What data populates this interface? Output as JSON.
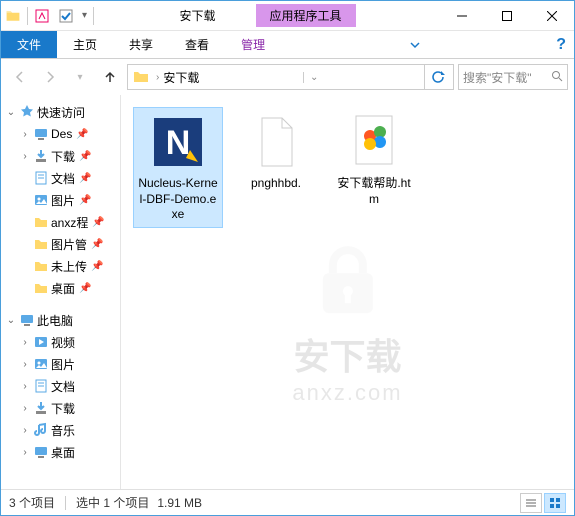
{
  "window": {
    "title": "安下载",
    "context_tab": "应用程序工具"
  },
  "ribbon": {
    "file": "文件",
    "home": "主页",
    "share": "共享",
    "view": "查看",
    "manage": "管理"
  },
  "breadcrumb": {
    "current": "安下载"
  },
  "search": {
    "placeholder": "搜索\"安下载\""
  },
  "sidebar": {
    "quick_access": "快速访问",
    "items_qa": [
      {
        "label": "Des",
        "icon": "desktop"
      },
      {
        "label": "下载",
        "icon": "downloads"
      },
      {
        "label": "文档",
        "icon": "documents"
      },
      {
        "label": "图片",
        "icon": "pictures"
      },
      {
        "label": "anxz程",
        "icon": "folder"
      },
      {
        "label": "图片管",
        "icon": "folder"
      },
      {
        "label": "未上传",
        "icon": "folder"
      },
      {
        "label": "桌面",
        "icon": "folder"
      }
    ],
    "this_pc": "此电脑",
    "items_pc": [
      {
        "label": "视频",
        "icon": "videos"
      },
      {
        "label": "图片",
        "icon": "pictures"
      },
      {
        "label": "文档",
        "icon": "documents"
      },
      {
        "label": "下载",
        "icon": "downloads"
      },
      {
        "label": "音乐",
        "icon": "music"
      },
      {
        "label": "桌面",
        "icon": "desktop"
      }
    ]
  },
  "files": [
    {
      "name": "Nucleus-Kernel-DBF-Demo.exe",
      "type": "exe",
      "selected": true
    },
    {
      "name": "pnghhbd.",
      "type": "file",
      "selected": false
    },
    {
      "name": "安下载帮助.htm",
      "type": "htm",
      "selected": false
    }
  ],
  "status": {
    "count": "3 个项目",
    "selected": "选中 1 个项目",
    "size": "1.91 MB"
  },
  "watermark": {
    "line1": "安下载",
    "line2": "anxz.com"
  }
}
